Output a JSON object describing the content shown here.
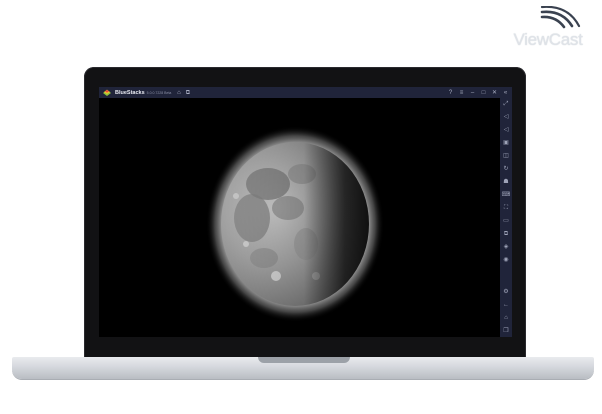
{
  "watermark": {
    "brand": "ViewCast"
  },
  "window": {
    "app_name": "BlueStacks",
    "app_version": "5.0.0.7228 Beta",
    "title_icons": [
      "home-icon",
      "multi-instance-icon"
    ],
    "controls": [
      "help-icon",
      "menu-icon",
      "minimize-icon",
      "maximize-icon",
      "close-icon",
      "collapse-sidebar-icon"
    ]
  },
  "sidebar": {
    "tools": [
      "fullscreen-icon",
      "volume-up-icon",
      "volume-down-icon",
      "screen-record-icon",
      "screenshot-icon",
      "rotate-icon",
      "shake-icon",
      "keymapping-icon",
      "screen-scale-icon",
      "folder-icon",
      "multi-instance-icon",
      "layers-icon",
      "eco-mode-icon",
      "settings-icon",
      "back-icon",
      "home-icon",
      "recent-apps-icon"
    ]
  },
  "content": {
    "image": "moon-phase-waning-gibbous"
  },
  "colors": {
    "titlebar": "#20243a",
    "screen": "#000000",
    "bezel": "#121214"
  }
}
